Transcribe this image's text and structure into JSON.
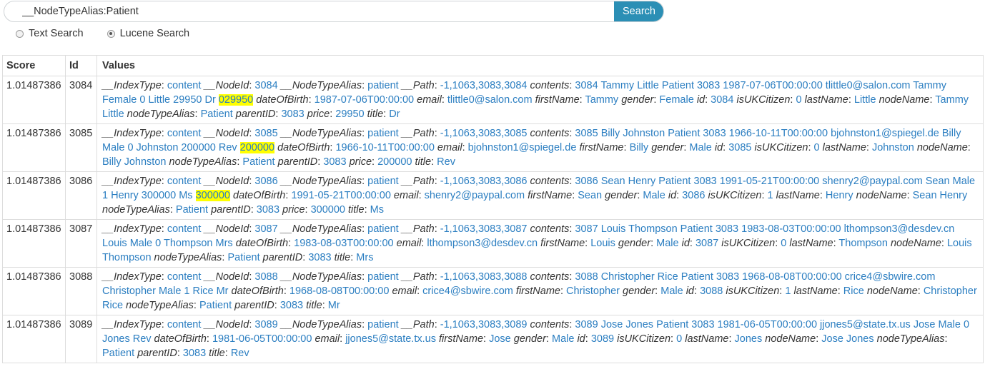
{
  "search": {
    "query": "__NodeTypeAlias:Patient",
    "button_label": "Search",
    "modes": [
      {
        "label": "Text Search",
        "selected": false
      },
      {
        "label": "Lucene Search",
        "selected": true
      }
    ]
  },
  "table": {
    "headers": {
      "score": "Score",
      "id": "Id",
      "values": "Values"
    },
    "rows": [
      {
        "score": "1.01487386",
        "id": "3084",
        "values": [
          {
            "k": "__IndexType",
            "v": "content"
          },
          {
            "k": "__NodeId",
            "v": "3084"
          },
          {
            "k": "__NodeTypeAlias",
            "v": "patient"
          },
          {
            "k": "__Path",
            "v": "-1,1063,3083,3084"
          },
          {
            "k": "contents",
            "v": "3084 Tammy Little Patient 3083 1987-07-06T00:00:00 tlittle0@salon.com Tammy Female 0 Little 29950 Dr ",
            "hl": "029950"
          },
          {
            "k": "dateOfBirth",
            "v": "1987-07-06T00:00:00"
          },
          {
            "k": "email",
            "v": "tlittle0@salon.com"
          },
          {
            "k": "firstName",
            "v": "Tammy"
          },
          {
            "k": "gender",
            "v": "Female"
          },
          {
            "k": "id",
            "v": "3084"
          },
          {
            "k": "isUKCitizen",
            "v": "0"
          },
          {
            "k": "lastName",
            "v": "Little"
          },
          {
            "k": "nodeName",
            "v": "Tammy Little"
          },
          {
            "k": "nodeTypeAlias",
            "v": "Patient"
          },
          {
            "k": "parentID",
            "v": "3083"
          },
          {
            "k": "price",
            "v": "29950"
          },
          {
            "k": "title",
            "v": "Dr"
          }
        ]
      },
      {
        "score": "1.01487386",
        "id": "3085",
        "values": [
          {
            "k": "__IndexType",
            "v": "content"
          },
          {
            "k": "__NodeId",
            "v": "3085"
          },
          {
            "k": "__NodeTypeAlias",
            "v": "patient"
          },
          {
            "k": "__Path",
            "v": "-1,1063,3083,3085"
          },
          {
            "k": "contents",
            "v": "3085 Billy Johnston Patient 3083 1966-10-11T00:00:00 bjohnston1@spiegel.de Billy Male 0 Johnston 200000 Rev ",
            "hl": "200000"
          },
          {
            "k": "dateOfBirth",
            "v": "1966-10-11T00:00:00"
          },
          {
            "k": "email",
            "v": "bjohnston1@spiegel.de"
          },
          {
            "k": "firstName",
            "v": "Billy"
          },
          {
            "k": "gender",
            "v": "Male"
          },
          {
            "k": "id",
            "v": "3085"
          },
          {
            "k": "isUKCitizen",
            "v": "0"
          },
          {
            "k": "lastName",
            "v": "Johnston"
          },
          {
            "k": "nodeName",
            "v": "Billy Johnston"
          },
          {
            "k": "nodeTypeAlias",
            "v": "Patient"
          },
          {
            "k": "parentID",
            "v": "3083"
          },
          {
            "k": "price",
            "v": "200000"
          },
          {
            "k": "title",
            "v": "Rev"
          }
        ]
      },
      {
        "score": "1.01487386",
        "id": "3086",
        "values": [
          {
            "k": "__IndexType",
            "v": "content"
          },
          {
            "k": "__NodeId",
            "v": "3086"
          },
          {
            "k": "__NodeTypeAlias",
            "v": "patient"
          },
          {
            "k": "__Path",
            "v": "-1,1063,3083,3086"
          },
          {
            "k": "contents",
            "v": "3086 Sean Henry Patient 3083 1991-05-21T00:00:00 shenry2@paypal.com Sean Male 1 Henry 300000 Ms ",
            "hl": "300000"
          },
          {
            "k": "dateOfBirth",
            "v": "1991-05-21T00:00:00"
          },
          {
            "k": "email",
            "v": "shenry2@paypal.com"
          },
          {
            "k": "firstName",
            "v": "Sean"
          },
          {
            "k": "gender",
            "v": "Male"
          },
          {
            "k": "id",
            "v": "3086"
          },
          {
            "k": "isUKCitizen",
            "v": "1"
          },
          {
            "k": "lastName",
            "v": "Henry"
          },
          {
            "k": "nodeName",
            "v": "Sean Henry"
          },
          {
            "k": "nodeTypeAlias",
            "v": "Patient"
          },
          {
            "k": "parentID",
            "v": "3083"
          },
          {
            "k": "price",
            "v": "300000"
          },
          {
            "k": "title",
            "v": "Ms"
          }
        ]
      },
      {
        "score": "1.01487386",
        "id": "3087",
        "values": [
          {
            "k": "__IndexType",
            "v": "content"
          },
          {
            "k": "__NodeId",
            "v": "3087"
          },
          {
            "k": "__NodeTypeAlias",
            "v": "patient"
          },
          {
            "k": "__Path",
            "v": "-1,1063,3083,3087"
          },
          {
            "k": "contents",
            "v": "3087 Louis Thompson Patient 3083 1983-08-03T00:00:00 lthompson3@desdev.cn Louis Male 0 Thompson Mrs"
          },
          {
            "k": "dateOfBirth",
            "v": "1983-08-03T00:00:00"
          },
          {
            "k": "email",
            "v": "lthompson3@desdev.cn"
          },
          {
            "k": "firstName",
            "v": "Louis"
          },
          {
            "k": "gender",
            "v": "Male"
          },
          {
            "k": "id",
            "v": "3087"
          },
          {
            "k": "isUKCitizen",
            "v": "0"
          },
          {
            "k": "lastName",
            "v": "Thompson"
          },
          {
            "k": "nodeName",
            "v": "Louis Thompson"
          },
          {
            "k": "nodeTypeAlias",
            "v": "Patient"
          },
          {
            "k": "parentID",
            "v": "3083"
          },
          {
            "k": "title",
            "v": "Mrs"
          }
        ]
      },
      {
        "score": "1.01487386",
        "id": "3088",
        "values": [
          {
            "k": "__IndexType",
            "v": "content"
          },
          {
            "k": "__NodeId",
            "v": "3088"
          },
          {
            "k": "__NodeTypeAlias",
            "v": "patient"
          },
          {
            "k": "__Path",
            "v": "-1,1063,3083,3088"
          },
          {
            "k": "contents",
            "v": "3088 Christopher Rice Patient 3083 1968-08-08T00:00:00 crice4@sbwire.com Christopher Male 1 Rice Mr"
          },
          {
            "k": "dateOfBirth",
            "v": "1968-08-08T00:00:00"
          },
          {
            "k": "email",
            "v": "crice4@sbwire.com"
          },
          {
            "k": "firstName",
            "v": "Christopher"
          },
          {
            "k": "gender",
            "v": "Male"
          },
          {
            "k": "id",
            "v": "3088"
          },
          {
            "k": "isUKCitizen",
            "v": "1"
          },
          {
            "k": "lastName",
            "v": "Rice"
          },
          {
            "k": "nodeName",
            "v": "Christopher Rice"
          },
          {
            "k": "nodeTypeAlias",
            "v": "Patient"
          },
          {
            "k": "parentID",
            "v": "3083"
          },
          {
            "k": "title",
            "v": "Mr"
          }
        ]
      },
      {
        "score": "1.01487386",
        "id": "3089",
        "values": [
          {
            "k": "__IndexType",
            "v": "content"
          },
          {
            "k": "__NodeId",
            "v": "3089"
          },
          {
            "k": "__NodeTypeAlias",
            "v": "patient"
          },
          {
            "k": "__Path",
            "v": "-1,1063,3083,3089"
          },
          {
            "k": "contents",
            "v": "3089 Jose Jones Patient 3083 1981-06-05T00:00:00 jjones5@state.tx.us Jose Male 0 Jones Rev"
          },
          {
            "k": "dateOfBirth",
            "v": "1981-06-05T00:00:00"
          },
          {
            "k": "email",
            "v": "jjones5@state.tx.us"
          },
          {
            "k": "firstName",
            "v": "Jose"
          },
          {
            "k": "gender",
            "v": "Male"
          },
          {
            "k": "id",
            "v": "3089"
          },
          {
            "k": "isUKCitizen",
            "v": "0"
          },
          {
            "k": "lastName",
            "v": "Jones"
          },
          {
            "k": "nodeName",
            "v": "Jose Jones"
          },
          {
            "k": "nodeTypeAlias",
            "v": "Patient"
          },
          {
            "k": "parentID",
            "v": "3083"
          },
          {
            "k": "title",
            "v": "Rev"
          }
        ]
      }
    ]
  },
  "colors": {
    "link": "#2b7ec1",
    "button": "#2b8fb5",
    "highlight": "#ffff00",
    "border": "#dddddd"
  }
}
